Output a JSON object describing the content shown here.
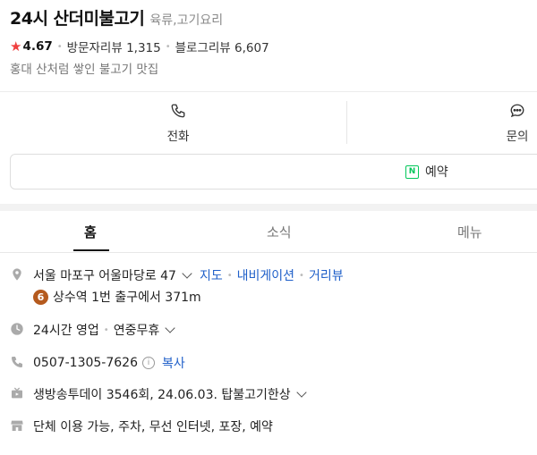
{
  "place": {
    "name": "24시 산더미불고기",
    "category": "육류,고기요리",
    "rating": "4.67",
    "visitor_reviews": "방문자리뷰 1,315",
    "blog_reviews": "블로그리뷰 6,607",
    "description": "홍대 산처럼 쌓인 불고기 맛집"
  },
  "actions": {
    "call_label": "전화",
    "ask_label": "문의",
    "reserve_label": "예약"
  },
  "tabs": {
    "home": "홈",
    "news": "소식",
    "menu": "메뉴"
  },
  "info": {
    "address": "서울 마포구 어울마당로 47",
    "map_link": "지도",
    "navigation_link": "내비게이션",
    "street_view_link": "거리뷰",
    "subway_line": "6",
    "subway_text": "상수역 1번 출구에서 371m",
    "hours": "24시간 영업",
    "holiday": "연중무휴",
    "phone": "0507-1305-7626",
    "copy_label": "복사",
    "tv": "생방송투데이 3546회, 24.06.03. 탑불고기한상",
    "amenities": "단체 이용 가능, 주차, 무선 인터넷, 포장, 예약"
  },
  "colors": {
    "star": "#ef3f3e",
    "link": "#2060c9",
    "naver_green": "#03c75a",
    "line6": "#b55a1e"
  }
}
